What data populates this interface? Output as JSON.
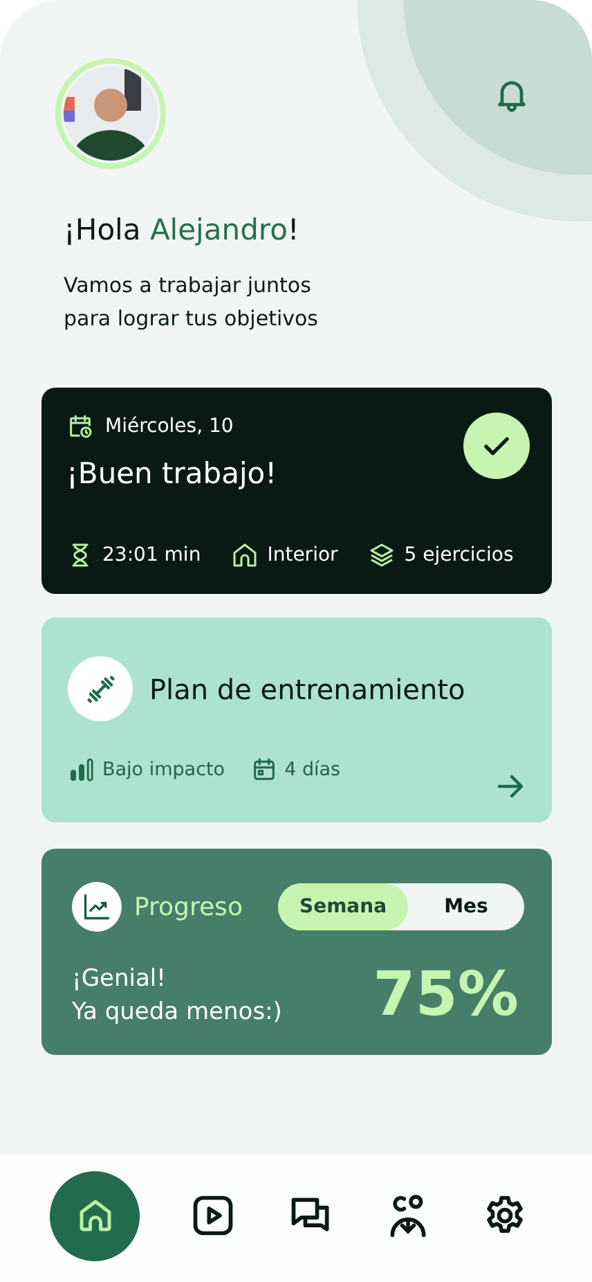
{
  "header": {
    "greeting_start": "¡Hola ",
    "name": "Alejandro",
    "greeting_end": "!",
    "subtitle_lines": [
      "Vamos a trabajar juntos",
      "para lograr tus objetivos"
    ]
  },
  "workout": {
    "date": "Miércoles, 10",
    "title": "¡Buen trabajo!",
    "done": true,
    "stats": [
      {
        "kind": "duration",
        "label": "23:01 min"
      },
      {
        "kind": "location",
        "label": "Interior"
      },
      {
        "kind": "exercises",
        "label": "5 ejercicios"
      }
    ]
  },
  "plan": {
    "title": "Plan de entrenamiento",
    "tags": [
      {
        "kind": "intensity",
        "label": "Bajo impacto"
      },
      {
        "kind": "days",
        "label": "4 días"
      }
    ]
  },
  "progress": {
    "title": "Progreso",
    "periods": [
      {
        "label": "Semana",
        "selected": true
      },
      {
        "label": "Mes",
        "selected": false
      }
    ],
    "message_lines": [
      "¡Genial!",
      "Ya queda menos:)"
    ],
    "percent": "75%"
  },
  "nav": [
    {
      "kind": "home",
      "selected": true
    },
    {
      "kind": "video",
      "selected": false
    },
    {
      "kind": "chat",
      "selected": false
    },
    {
      "kind": "community",
      "selected": false
    },
    {
      "kind": "settings",
      "selected": false
    }
  ]
}
